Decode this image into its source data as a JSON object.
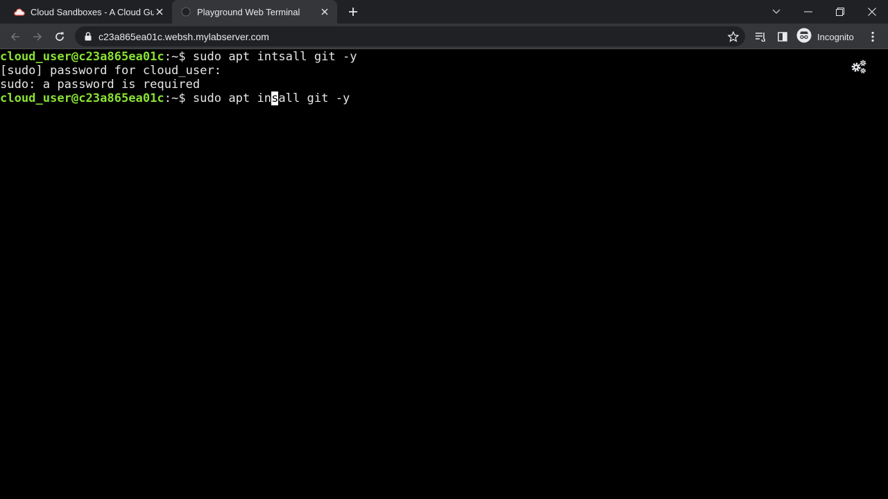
{
  "browser": {
    "tabs": [
      {
        "title": "Cloud Sandboxes - A Cloud Guru",
        "icon": "cloud-icon",
        "active": false
      },
      {
        "title": "Playground Web Terminal",
        "icon": "terminal-favicon-icon",
        "active": true
      }
    ],
    "url": "c23a865ea01c.websh.mylabserver.com",
    "profile_label": "Incognito"
  },
  "terminal": {
    "lines": [
      {
        "user_host": "cloud_user@c23a865ea01c",
        "path": ":~$",
        "command": " sudo apt intsall git -y"
      },
      {
        "text": "[sudo] password for cloud_user:"
      },
      {
        "text": "sudo: a password is required"
      },
      {
        "user_host": "cloud_user@c23a865ea01c",
        "path": ":~$",
        "command_before_cursor": " sudo apt in",
        "cursor_char": "s",
        "command_after_cursor": "all git -y"
      }
    ]
  },
  "colors": {
    "prompt_user": "#8ae234",
    "terminal_bg": "#000000",
    "terminal_fg": "#e6e6e6",
    "tab_strip": "#202124",
    "toolbar": "#35363a"
  }
}
